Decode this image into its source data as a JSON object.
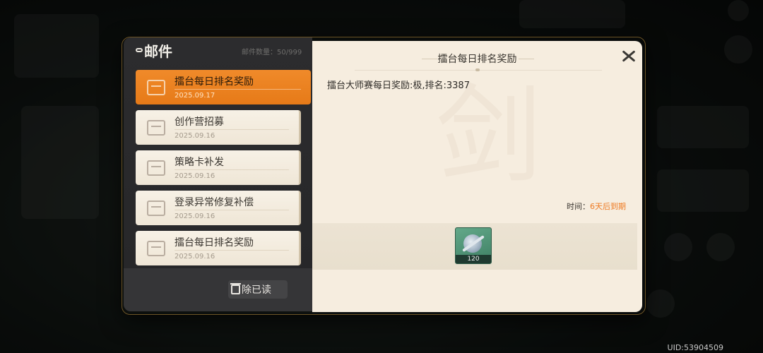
{
  "mail": {
    "title": "邮件",
    "count_label": "邮件数量：50/999",
    "items": [
      {
        "subject": "擂台每日排名奖励",
        "date": "2025.09.17",
        "active": true
      },
      {
        "subject": "创作营招募",
        "date": "2025.09.16",
        "active": false
      },
      {
        "subject": "策略卡补发",
        "date": "2025.09.16",
        "active": false
      },
      {
        "subject": "登录异常修复补偿",
        "date": "2025.09.16",
        "active": false
      },
      {
        "subject": "擂台每日排名奖励",
        "date": "2025.09.16",
        "active": false
      }
    ],
    "delete_read_label": "除已读"
  },
  "detail": {
    "title": "擂台每日排名奖励",
    "content": "擂台大师赛每日奖励:极,排名:3387",
    "time_label": "时间：",
    "time_value": "6天后到期",
    "reward": {
      "quantity": "120",
      "icon": "sword-token-icon"
    }
  },
  "footer": {
    "uid": "UID:53904509"
  },
  "colors": {
    "accent": "#ee7a22",
    "active_item": "#f08a2a",
    "panel": "#f6eddf"
  }
}
